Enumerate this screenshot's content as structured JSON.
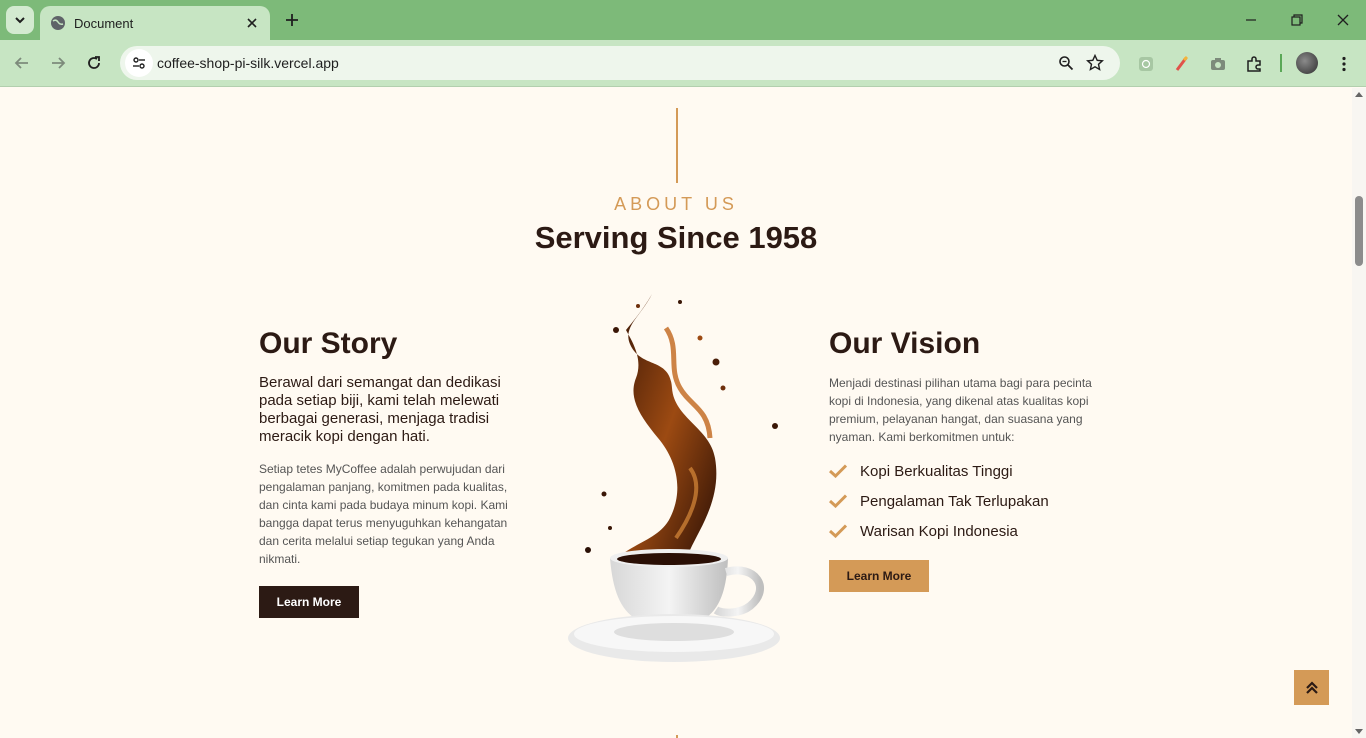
{
  "browser": {
    "tab_title": "Document",
    "url": "coffee-shop-pi-silk.vercel.app",
    "icons": [
      "tab-search-icon",
      "globe-icon",
      "close-icon",
      "plus-icon",
      "minimize-icon",
      "restore-icon",
      "close-window-icon",
      "back-icon",
      "forward-icon",
      "reload-icon",
      "site-info-icon",
      "zoom-icon",
      "star-icon",
      "extension-icon",
      "avatar"
    ]
  },
  "about": {
    "eyebrow": "ABOUT US",
    "heading": "Serving Since 1958"
  },
  "story": {
    "title": "Our Story",
    "lead": "Berawal dari semangat dan dedikasi pada setiap biji, kami telah melewati berbagai generasi, menjaga tradisi meracik kopi dengan hati.",
    "body": "Setiap tetes MyCoffee adalah perwujudan dari pengalaman panjang, komitmen pada kualitas, dan cinta kami pada budaya minum kopi. Kami bangga dapat terus menyuguhkan kehangatan dan cerita melalui setiap tegukan yang Anda nikmati.",
    "button": "Learn More"
  },
  "vision": {
    "title": "Our Vision",
    "body": "Menjadi destinasi pilihan utama bagi para pecinta kopi di Indonesia, yang dikenal atas kualitas kopi premium, pelayanan hangat, dan suasana yang nyaman. Kami berkomitmen untuk:",
    "items": [
      "Kopi Berkualitas Tinggi",
      "Pengalaman Tak Terlupakan",
      "Warisan Kopi Indonesia"
    ],
    "button": "Learn More"
  },
  "colors": {
    "accent": "#d49a57",
    "dark": "#2c1a14",
    "background": "#fffaf2",
    "chrome": "#7dba79"
  }
}
